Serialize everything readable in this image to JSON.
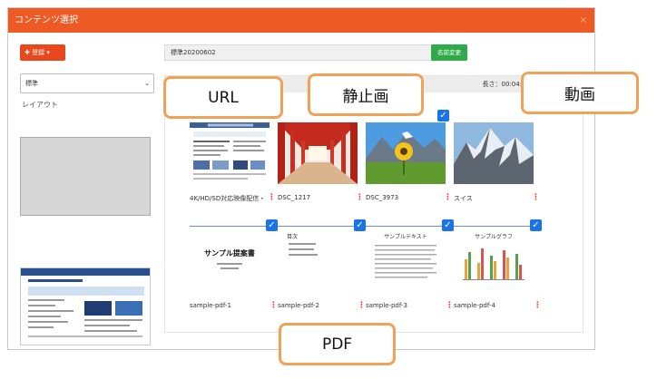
{
  "dialog": {
    "title": "コンテンツ選択",
    "close": "×"
  },
  "toolbar": {
    "register_label": "✚ 登録 ▾"
  },
  "name": {
    "value": "標準20200602",
    "rename_label": "名前変更"
  },
  "layout": {
    "selected": "標準",
    "label": "レイアウト"
  },
  "panel": {
    "length_label": "長さ：00:04:46"
  },
  "tiles": [
    {
      "label": "4K/HD/SD対応映像配信・…"
    },
    {
      "label": "DSC_1217"
    },
    {
      "label": "DSC_3973"
    },
    {
      "label": "スイス"
    },
    {
      "label": "sample-pdf-1"
    },
    {
      "label": "sample-pdf-2"
    },
    {
      "label": "sample-pdf-3"
    },
    {
      "label": "sample-pdf-4"
    }
  ],
  "pdf_thumbs": {
    "t1_title": "サンプル提案書",
    "t2_title": "目次",
    "t3_title": "サンプルテキスト",
    "t4_title": "サンプルグラフ"
  },
  "callouts": {
    "url": "URL",
    "still": "静止画",
    "video": "動画",
    "pdf": "PDF"
  },
  "colors": {
    "title_bar": "#ee5a24",
    "check": "#1a73e8",
    "callout_border": "#f0a259"
  }
}
